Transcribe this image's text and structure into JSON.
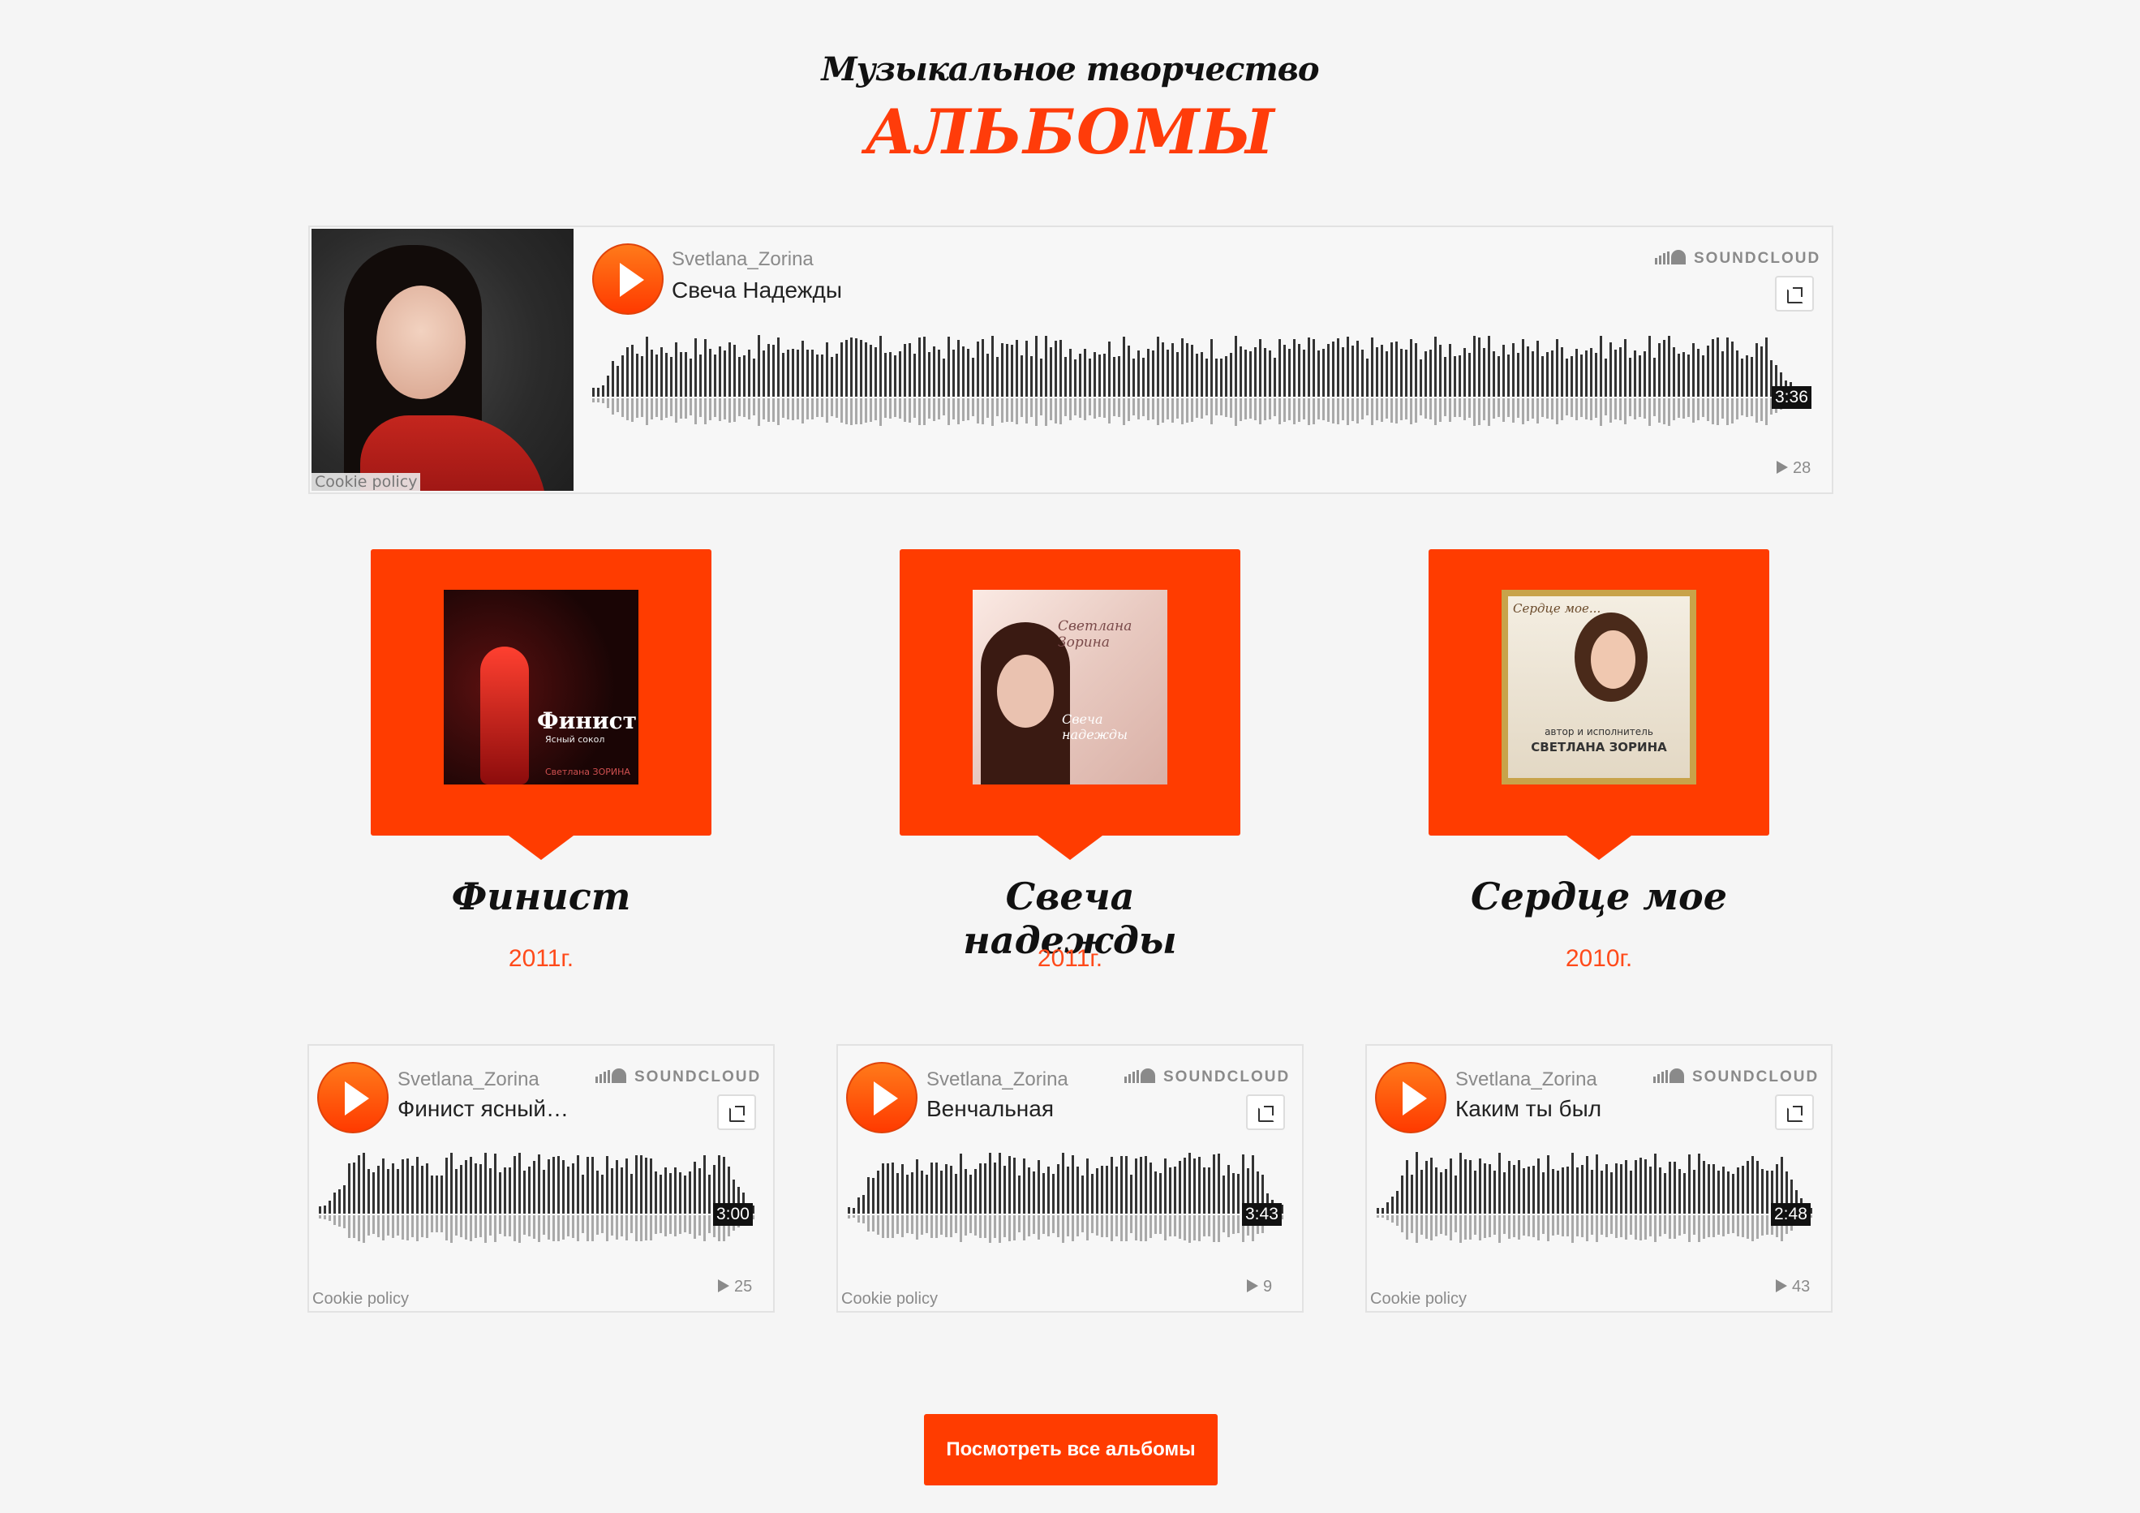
{
  "header": {
    "subtitle": "Музыкальное творчество",
    "title": "АЛЬБОМЫ"
  },
  "colors": {
    "accent": "#ff3c00",
    "wave_dark": "#333333",
    "wave_light": "#a9a9a9"
  },
  "main_player": {
    "user": "Svetlana_Zorina",
    "track": "Свеча Надежды",
    "duration": "3:36",
    "plays": "28",
    "logo": "SOUNDCLOUD",
    "cookie": "Cookie policy"
  },
  "albums": [
    {
      "name": "Финист",
      "year": "2011г.",
      "cover_text": "Финист",
      "cover_sub": "Ясный сокол",
      "cover_artist": "Светлана ЗОРИНА"
    },
    {
      "name": "Свеча надежды",
      "year": "2011г.",
      "cover_text": "Светлана Зорина",
      "cover_sub": "Свеча надежды"
    },
    {
      "name": "Сердце мое",
      "year": "2010г.",
      "cover_text": "Сердце мое...",
      "cover_sub": "автор и исполнитель",
      "cover_artist": "СВЕТЛАНА ЗОРИНА"
    }
  ],
  "players": [
    {
      "user": "Svetlana_Zorina",
      "track": "Финист ясный…",
      "duration": "3:00",
      "plays": "25",
      "logo": "SOUNDCLOUD",
      "cookie": "Cookie policy"
    },
    {
      "user": "Svetlana_Zorina",
      "track": "Венчальная",
      "duration": "3:43",
      "plays": "9",
      "logo": "SOUNDCLOUD",
      "cookie": "Cookie policy"
    },
    {
      "user": "Svetlana_Zorina",
      "track": "Каким ты был",
      "duration": "2:48",
      "plays": "43",
      "logo": "SOUNDCLOUD",
      "cookie": "Cookie policy"
    }
  ],
  "button": {
    "view_all": "Посмотреть все альбомы"
  }
}
